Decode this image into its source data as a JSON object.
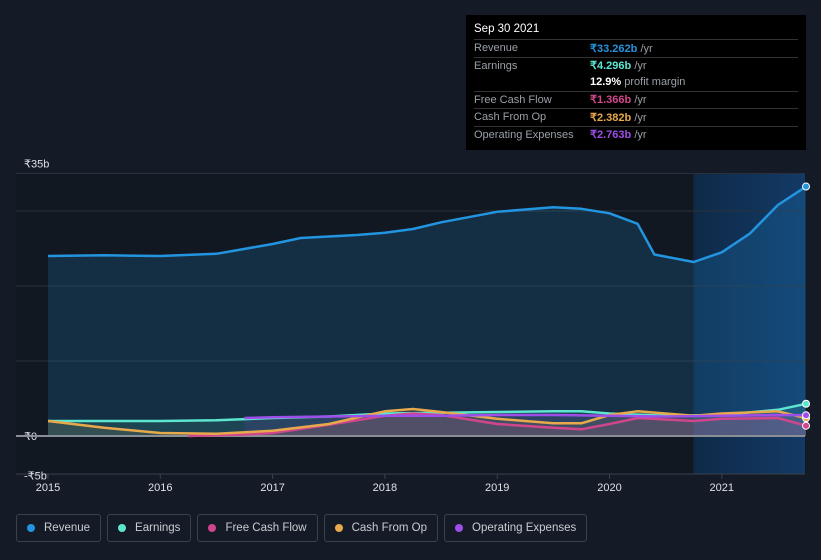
{
  "tooltip": {
    "date": "Sep 30 2021",
    "rows": [
      {
        "label": "Revenue",
        "value": "₹33.262b",
        "unit": "/yr",
        "color": "#2394df"
      },
      {
        "label": "Earnings",
        "value": "₹4.296b",
        "unit": "/yr",
        "color": "#5ce6d0"
      },
      {
        "label": "",
        "value": "12.9%",
        "unit": "profit margin",
        "color": "#ffffff"
      },
      {
        "label": "Free Cash Flow",
        "value": "₹1.366b",
        "unit": "/yr",
        "color": "#d0468c"
      },
      {
        "label": "Cash From Op",
        "value": "₹2.382b",
        "unit": "/yr",
        "color": "#e8a84c"
      },
      {
        "label": "Operating Expenses",
        "value": "₹2.763b",
        "unit": "/yr",
        "color": "#9d4ee8"
      }
    ]
  },
  "chart_data": {
    "type": "area",
    "yticks": [
      {
        "v": 35,
        "label": "₹35b"
      },
      {
        "v": 0,
        "label": "₹0"
      },
      {
        "v": -5,
        "label": "-₹5b"
      }
    ],
    "ylim": [
      -5,
      35
    ],
    "xlim": [
      2015,
      2021.75
    ],
    "xticks": [
      "2015",
      "2016",
      "2017",
      "2018",
      "2019",
      "2020",
      "2021"
    ],
    "highlight_from": 2020.75,
    "grid": true,
    "legend_position": "bottom",
    "series": [
      {
        "name": "Revenue",
        "color": "#2394df",
        "x": [
          2015,
          2015.5,
          2016,
          2016.5,
          2017,
          2017.25,
          2017.75,
          2018,
          2018.25,
          2018.5,
          2019,
          2019.5,
          2019.75,
          2020,
          2020.25,
          2020.4,
          2020.75,
          2021,
          2021.25,
          2021.5,
          2021.75
        ],
        "y": [
          24.0,
          24.1,
          24.0,
          24.3,
          25.6,
          26.4,
          26.8,
          27.1,
          27.6,
          28.5,
          29.9,
          30.5,
          30.3,
          29.7,
          28.3,
          24.2,
          23.2,
          24.5,
          27.0,
          30.8,
          33.26
        ]
      },
      {
        "name": "Earnings",
        "color": "#5ce6d0",
        "x": [
          2015,
          2015.5,
          2016,
          2016.5,
          2017,
          2017.5,
          2018,
          2018.5,
          2019,
          2019.5,
          2019.75,
          2020,
          2020.5,
          2021,
          2021.5,
          2021.75
        ],
        "y": [
          2.0,
          2.0,
          2.0,
          2.1,
          2.4,
          2.6,
          3.0,
          3.1,
          3.2,
          3.3,
          3.3,
          3.0,
          2.7,
          2.8,
          3.5,
          4.3
        ]
      },
      {
        "name": "Free Cash Flow",
        "color": "#d0468c",
        "x": [
          2016.25,
          2016.75,
          2017,
          2017.5,
          2018,
          2018.25,
          2018.5,
          2019,
          2019.5,
          2019.75,
          2020,
          2020.25,
          2020.75,
          2021,
          2021.5,
          2021.75
        ],
        "y": [
          0,
          0.2,
          0.4,
          1.5,
          2.7,
          3.0,
          2.8,
          1.6,
          1.1,
          0.9,
          1.6,
          2.4,
          2.0,
          2.3,
          2.4,
          1.37
        ]
      },
      {
        "name": "Cash From Op",
        "color": "#e8a84c",
        "x": [
          2015,
          2015.5,
          2016,
          2016.5,
          2017,
          2017.5,
          2018,
          2018.25,
          2018.5,
          2019,
          2019.5,
          2019.75,
          2020,
          2020.25,
          2020.75,
          2021,
          2021.5,
          2021.75
        ],
        "y": [
          2.0,
          1.1,
          0.4,
          0.3,
          0.7,
          1.6,
          3.3,
          3.6,
          3.2,
          2.3,
          1.7,
          1.7,
          2.8,
          3.3,
          2.7,
          3.0,
          3.3,
          2.38
        ]
      },
      {
        "name": "Operating Expenses",
        "color": "#9d4ee8",
        "x": [
          2016.75,
          2017,
          2017.5,
          2018,
          2018.5,
          2019,
          2019.5,
          2020,
          2020.5,
          2021,
          2021.5,
          2021.75
        ],
        "y": [
          2.4,
          2.5,
          2.6,
          2.7,
          2.7,
          2.8,
          2.8,
          2.7,
          2.6,
          2.7,
          2.8,
          2.76
        ]
      }
    ]
  }
}
